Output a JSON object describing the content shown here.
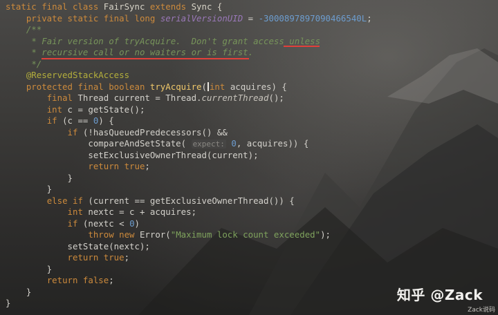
{
  "code": {
    "lines": [
      [
        {
          "t": "kw",
          "v": "static final class "
        },
        {
          "t": "cls",
          "v": "FairSync "
        },
        {
          "t": "kw",
          "v": "extends "
        },
        {
          "t": "cls",
          "v": "Sync {"
        }
      ],
      [
        {
          "t": "pl",
          "v": "    "
        },
        {
          "t": "kw",
          "v": "private static final long "
        },
        {
          "t": "field",
          "v": "serialVersionUID"
        },
        {
          "t": "pl",
          "v": " = "
        },
        {
          "t": "num",
          "v": "-3000897897090466540L"
        },
        {
          "t": "pl",
          "v": ";"
        }
      ],
      [
        {
          "t": "pl",
          "v": "    "
        },
        {
          "t": "cmt",
          "v": "/**"
        }
      ],
      [
        {
          "t": "pl",
          "v": "     "
        },
        {
          "t": "cmt",
          "v": "* Fair version of tryAcquire.  Don't grant access unless"
        }
      ],
      [
        {
          "t": "pl",
          "v": "     "
        },
        {
          "t": "cmt",
          "v": "* recursive call or no waiters or is first."
        }
      ],
      [
        {
          "t": "pl",
          "v": "     "
        },
        {
          "t": "cmt",
          "v": "*/"
        }
      ],
      [
        {
          "t": "pl",
          "v": "    "
        },
        {
          "t": "ann",
          "v": "@ReservedStackAccess"
        }
      ],
      [
        {
          "t": "pl",
          "v": "    "
        },
        {
          "t": "kw",
          "v": "protected final boolean "
        },
        {
          "t": "meth",
          "v": "tryAcquire"
        },
        {
          "t": "pl",
          "v": "("
        },
        {
          "t": "caret",
          "v": ""
        },
        {
          "t": "kw",
          "v": "int "
        },
        {
          "t": "pl",
          "v": "acquires) {"
        }
      ],
      [
        {
          "t": "pl",
          "v": "        "
        },
        {
          "t": "kw",
          "v": "final "
        },
        {
          "t": "pl",
          "v": "Thread current = Thread."
        },
        {
          "t": "sm",
          "v": "currentThread"
        },
        {
          "t": "pl",
          "v": "();"
        }
      ],
      [
        {
          "t": "pl",
          "v": "        "
        },
        {
          "t": "kw",
          "v": "int "
        },
        {
          "t": "pl",
          "v": "c = getState();"
        }
      ],
      [
        {
          "t": "pl",
          "v": "        "
        },
        {
          "t": "kw",
          "v": "if "
        },
        {
          "t": "pl",
          "v": "(c == "
        },
        {
          "t": "num",
          "v": "0"
        },
        {
          "t": "pl",
          "v": ") {"
        }
      ],
      [
        {
          "t": "pl",
          "v": "            "
        },
        {
          "t": "kw",
          "v": "if "
        },
        {
          "t": "pl",
          "v": "(!hasQueuedPredecessors() &&"
        }
      ],
      [
        {
          "t": "pl",
          "v": "                compareAndSetState( "
        },
        {
          "t": "hint",
          "v": "expect:"
        },
        {
          "t": "pl",
          "v": " "
        },
        {
          "t": "num",
          "v": "0"
        },
        {
          "t": "pl",
          "v": ", acquires)) {"
        }
      ],
      [
        {
          "t": "pl",
          "v": "                setExclusiveOwnerThread(current);"
        }
      ],
      [
        {
          "t": "pl",
          "v": "                "
        },
        {
          "t": "kw",
          "v": "return true"
        },
        {
          "t": "pl",
          "v": ";"
        }
      ],
      [
        {
          "t": "pl",
          "v": "            }"
        }
      ],
      [
        {
          "t": "pl",
          "v": "        }"
        }
      ],
      [
        {
          "t": "pl",
          "v": "        "
        },
        {
          "t": "kw",
          "v": "else if "
        },
        {
          "t": "pl",
          "v": "(current == getExclusiveOwnerThread()) {"
        }
      ],
      [
        {
          "t": "pl",
          "v": "            "
        },
        {
          "t": "kw",
          "v": "int "
        },
        {
          "t": "pl",
          "v": "nextc = c + acquires;"
        }
      ],
      [
        {
          "t": "pl",
          "v": "            "
        },
        {
          "t": "kw",
          "v": "if "
        },
        {
          "t": "pl",
          "v": "(nextc < "
        },
        {
          "t": "num",
          "v": "0"
        },
        {
          "t": "pl",
          "v": ")"
        }
      ],
      [
        {
          "t": "pl",
          "v": "                "
        },
        {
          "t": "kw",
          "v": "throw new "
        },
        {
          "t": "pl",
          "v": "Error("
        },
        {
          "t": "str",
          "v": "\"Maximum lock count exceeded\""
        },
        {
          "t": "pl",
          "v": ");"
        }
      ],
      [
        {
          "t": "pl",
          "v": "            setState(nextc);"
        }
      ],
      [
        {
          "t": "pl",
          "v": "            "
        },
        {
          "t": "kw",
          "v": "return true"
        },
        {
          "t": "pl",
          "v": ";"
        }
      ],
      [
        {
          "t": "pl",
          "v": "        }"
        }
      ],
      [
        {
          "t": "pl",
          "v": "        "
        },
        {
          "t": "kw",
          "v": "return false"
        },
        {
          "t": "pl",
          "v": ";"
        }
      ],
      [
        {
          "t": "pl",
          "v": "    }"
        }
      ],
      [
        {
          "t": "pl",
          "v": "}"
        }
      ]
    ]
  },
  "watermark": {
    "main": "知乎 @Zack",
    "sub": "Zack说码"
  },
  "colors": {
    "keyword": "#cc8a3c",
    "comment": "#77945a",
    "number": "#6d9dcf",
    "string": "#7fa35d",
    "annotation": "#b3ae3c",
    "method_decl": "#f0c86a",
    "underline": "#e2403a"
  }
}
